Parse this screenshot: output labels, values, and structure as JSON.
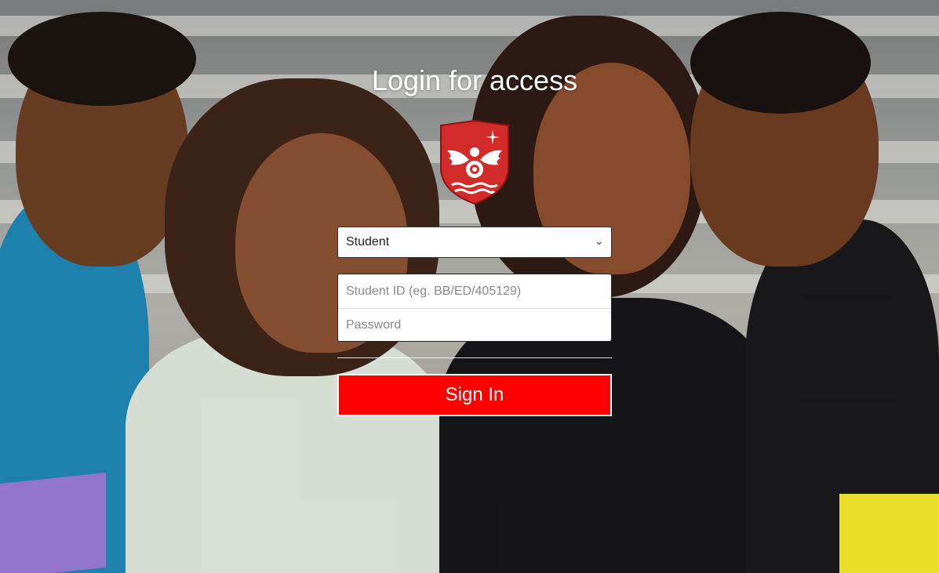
{
  "page": {
    "title": "Login for access"
  },
  "form": {
    "role_select": {
      "selected": "Student"
    },
    "student_id": {
      "placeholder": "Student ID (eg. BB/ED/405129)",
      "value": ""
    },
    "password": {
      "placeholder": "Password",
      "value": ""
    },
    "signin_label": "Sign In"
  },
  "icons": {
    "select_arrow": "chevron-down-icon",
    "crest": "eagle-crest-icon"
  },
  "colors": {
    "button_bg": "#ff0000",
    "button_text": "#ffffff",
    "crest_red": "#d32a2a",
    "title_text": "#ffffff"
  }
}
